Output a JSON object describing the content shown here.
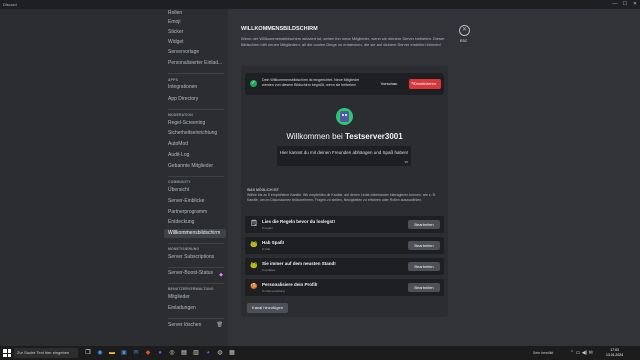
{
  "window": {
    "title": "Discord",
    "controls": [
      "—",
      "☐",
      "✕"
    ]
  },
  "sidebar": {
    "top_items": [
      "Rollen",
      "Emoji",
      "Sticker",
      "Widget",
      "Servervorlage",
      "Personalisierter Einlad..."
    ],
    "apps": {
      "header": "APPS",
      "items": [
        "Integrationen",
        "App Directory"
      ]
    },
    "moderation": {
      "header": "MODERATION",
      "items": [
        "Regel-Screening",
        "Sicherheitseinrichtung",
        "AutoMod",
        "Audit-Log",
        "Gebannte Mitglieder"
      ]
    },
    "community": {
      "header": "COMMUNITY",
      "items": [
        "Übersicht",
        "Server-Einblicke",
        "Partnerprogramm",
        "Entdeckung",
        "Willkommensbildschirm"
      ]
    },
    "monetization": {
      "header": "MONETISIERUNG",
      "items": [
        "Server Subscriptions"
      ]
    },
    "boost": {
      "label": "Server-Boost-Status",
      "icon": "boost-gem-icon"
    },
    "user_management": {
      "header": "BENUTZERVERWALTUNG",
      "items": [
        "Mitglieder",
        "Einladungen"
      ]
    },
    "delete": {
      "label": "Server löschen",
      "icon": "trash-icon"
    },
    "active_item": "Willkommensbildschirm"
  },
  "main": {
    "title": "WILLKOMMENSBILDSCHIRM",
    "intro": "Wenn der Willkommensbildschirm aktiviert ist, sehen ihn neue Mitglieder, wenn sie deinem Server beitreten. Dieser Bildschirm hilft neuen Mitgliedern, all die coolen Dinge zu entdecken, die sie auf deinem Server erstellen können!",
    "close": {
      "icon": "close-icon",
      "label": "ESC"
    },
    "notice": {
      "text": "Dein Willkommensbildschirm ist eingerichtet. Neue Mitglieder werden von diesem Bildschirm begrüßt, wenn sie beitreten!",
      "preview_label": "Vorschau",
      "deactivate_label": "Deaktivieren"
    },
    "preview": {
      "welcome_prefix": "Willkommen bei ",
      "server_name": "Testserver3001",
      "description": "Hier kannst du mit deinen Freunden abhängen und Spaß haben!",
      "char_count": "95"
    },
    "things_to_do": {
      "header": "WAS MÖGLICH IST",
      "description": "Wähle bis zu 5 empfohlene Kanäle. Wir empfehlen dir Kanäle, auf denen Leute miteinander interagieren können, wie z. B. Kanäle, um im Diskussionen teilzunehmen, Fragen zu stellen, Neuigkeiten zu erfahren oder Rollen auszuwählen.",
      "items": [
        {
          "emoji": "🗒",
          "title": "Lies die Regeln bevor du loslegst!",
          "channel": "# regeln"
        },
        {
          "emoji": "🐸",
          "title": "Hab Spaß!",
          "channel": "# chat"
        },
        {
          "emoji": "🐸",
          "title": "Sie immer auf dem neusten Stand!",
          "channel": "# updates"
        },
        {
          "emoji": "🍪",
          "title": "Personalisiere dein Profil!",
          "channel": "# rollenverteilung"
        }
      ],
      "edit_label": "Bearbeiten",
      "add_label": "Kanal hinzufügen"
    }
  },
  "taskbar": {
    "search_placeholder": "Zur Suche Text hier eingeben",
    "tray_text": "Sehr bewölkt",
    "time": "17:03",
    "date": "13.01.2024"
  },
  "colors": {
    "accent_green": "#23a55a",
    "danger_red": "#da373c",
    "sidebar_bg": "#2b2d31",
    "main_bg": "#313338"
  }
}
